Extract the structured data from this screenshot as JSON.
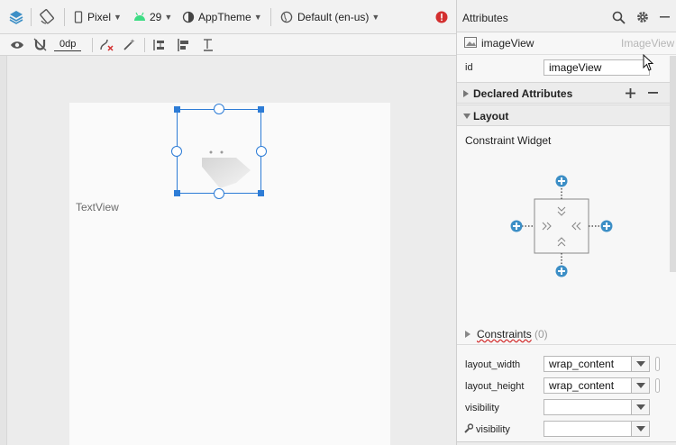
{
  "toolbar": {
    "device": "Pixel",
    "api_level": "29",
    "theme": "AppTheme",
    "locale": "Default (en-us)",
    "margin": "0dp"
  },
  "canvas": {
    "textview_label": "TextView"
  },
  "attributes": {
    "header_title": "Attributes",
    "component_name": "imageView",
    "component_type": "ImageView",
    "id_label": "id",
    "id_value": "imageView",
    "declared_section": "Declared Attributes",
    "layout_section": "Layout",
    "constraint_widget_label": "Constraint Widget",
    "constraints_label": "Constraints",
    "constraints_count": "(0)",
    "layout_width_label": "layout_width",
    "layout_width_value": "wrap_content",
    "layout_height_label": "layout_height",
    "layout_height_value": "wrap_content",
    "visibility_label": "visibility",
    "visibility_value": "",
    "tools_visibility_label": "visibility",
    "tools_visibility_value": ""
  },
  "colors": {
    "accent": "#2d7cd6",
    "constraint_plus": "#3d8fc6",
    "android_green": "#3ddc84",
    "error_red": "#d32f2f"
  }
}
